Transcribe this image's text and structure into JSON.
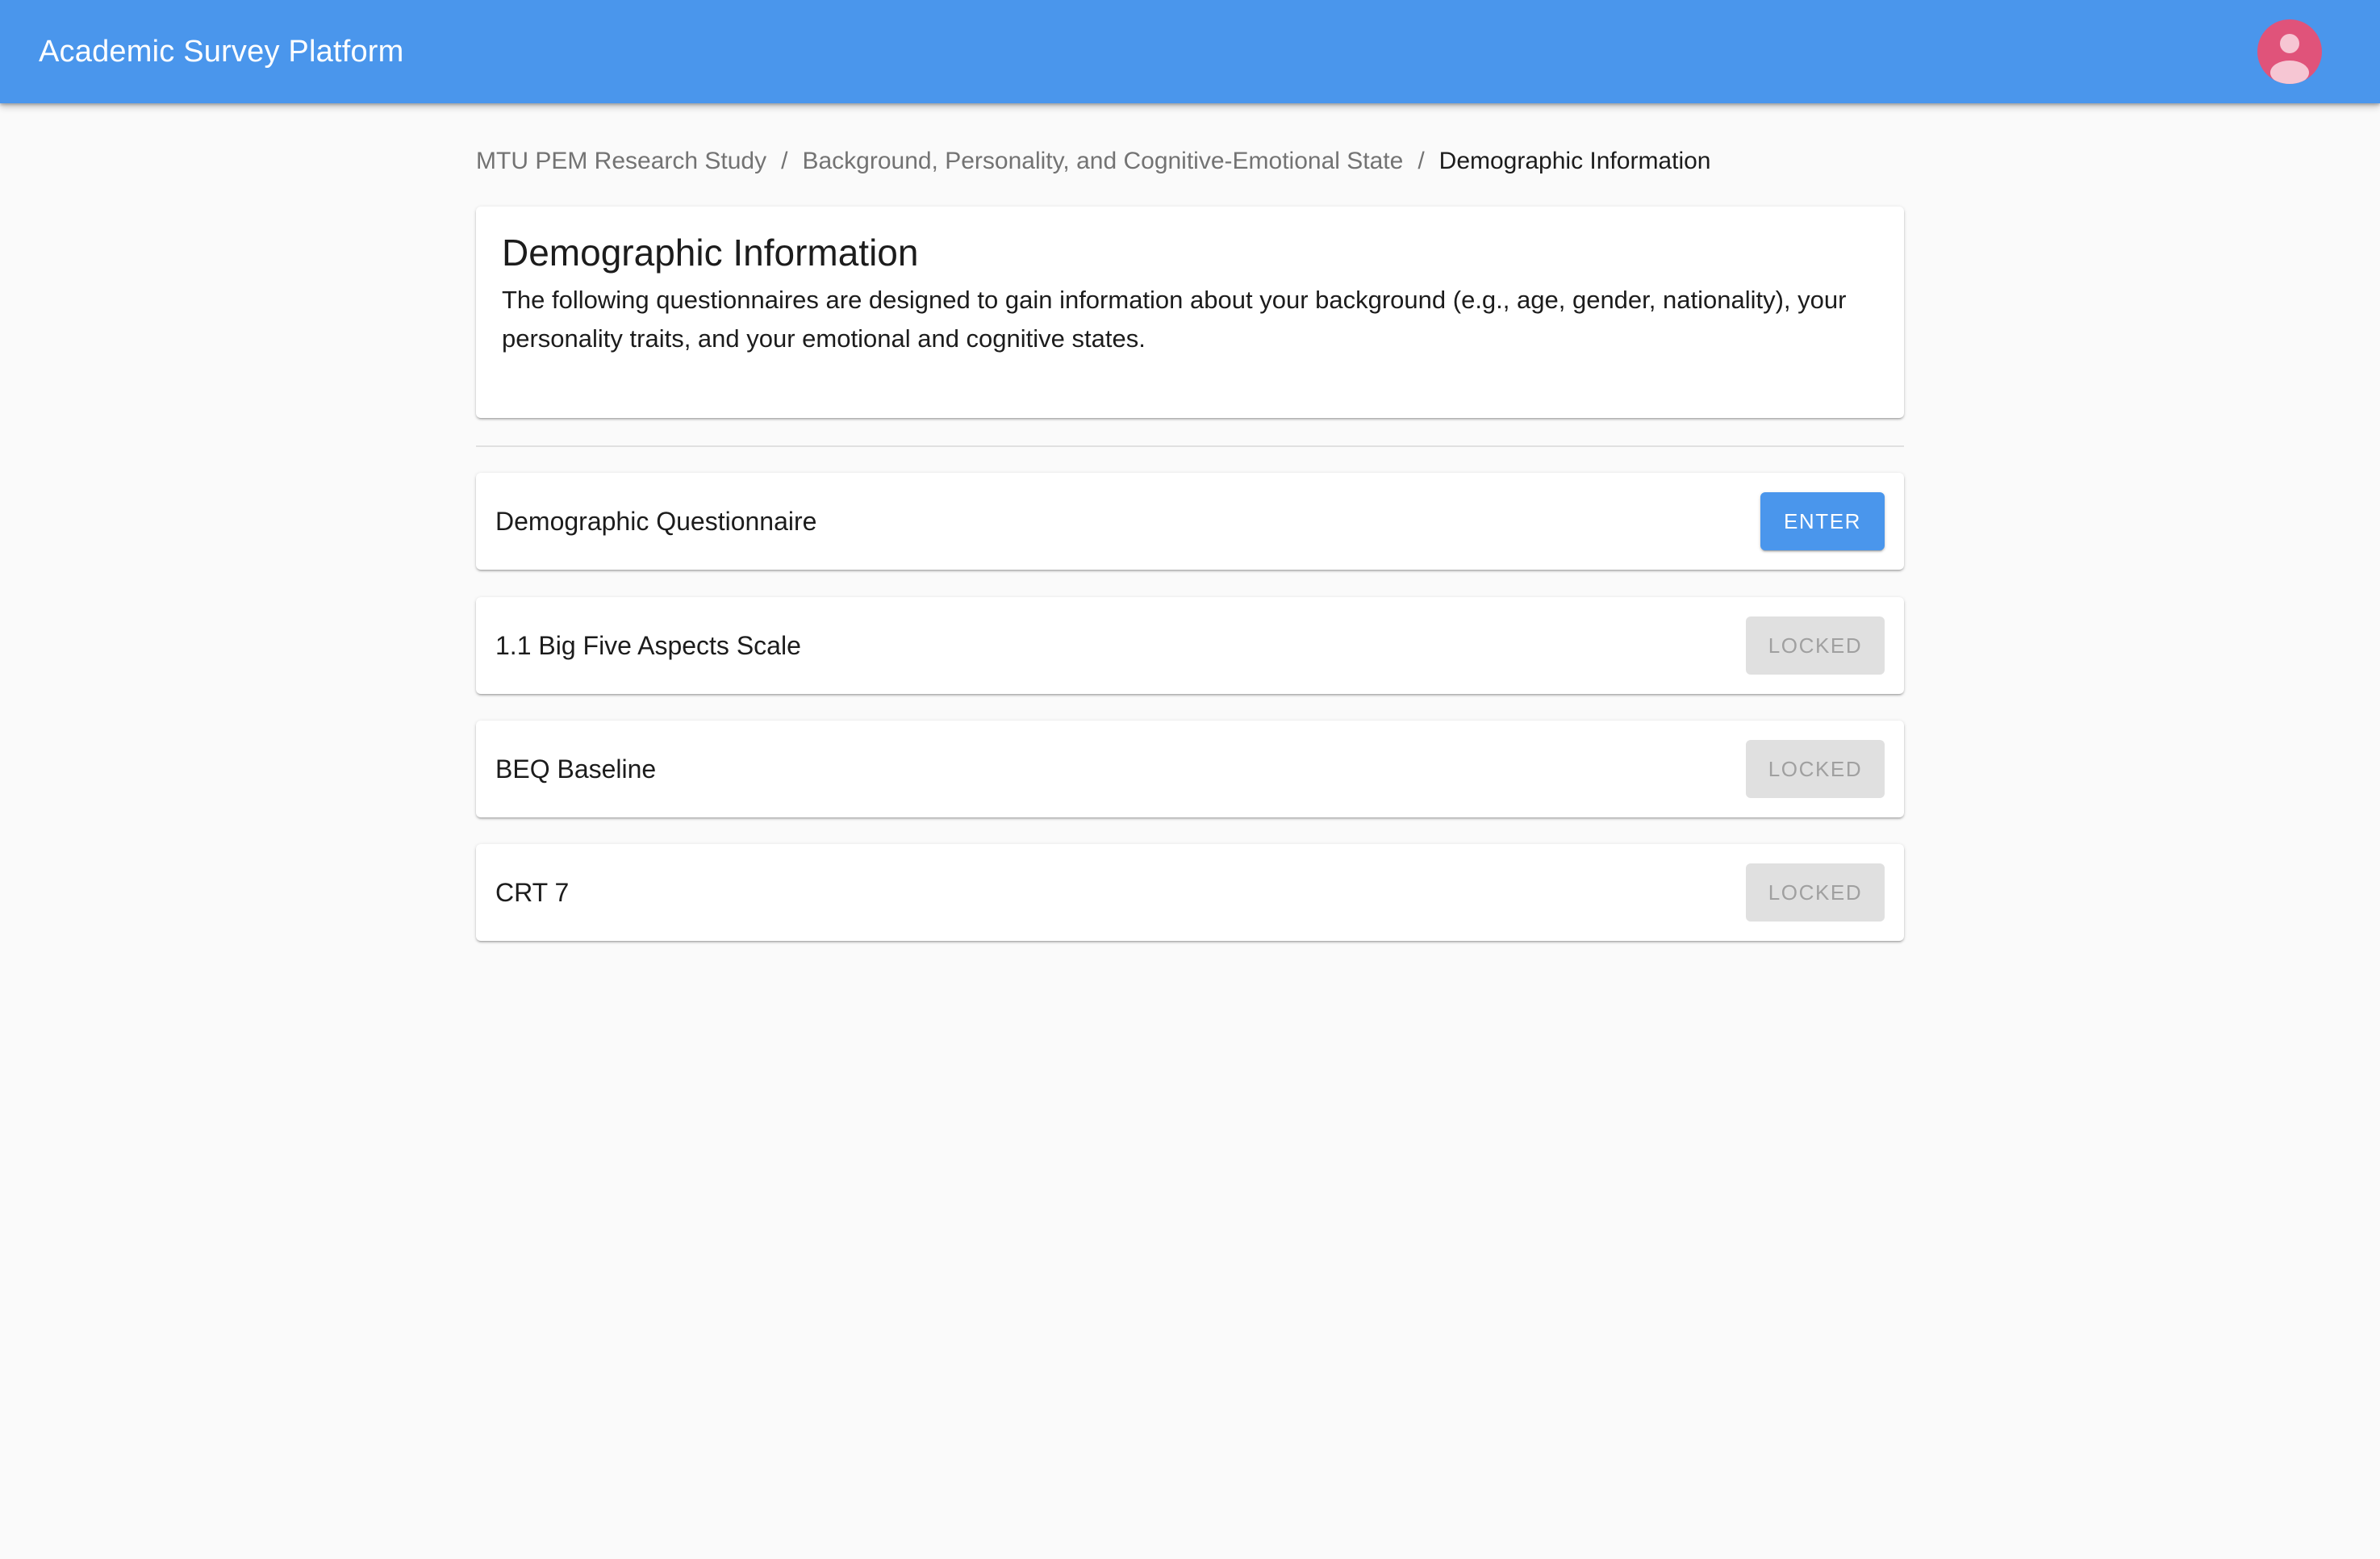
{
  "app": {
    "title": "Academic Survey Platform",
    "avatar_icon": "account-icon"
  },
  "breadcrumb": {
    "items": [
      "MTU PEM Research Study",
      "Background, Personality, and Cognitive-Emotional State"
    ],
    "separator": "/",
    "current": "Demographic Information"
  },
  "section": {
    "title": "Demographic Information",
    "description": "The following questionnaires are designed to gain information about your background (e.g., age, gender, nationality), your personality traits, and your emotional and cognitive states."
  },
  "questionnaires": [
    {
      "name": "Demographic Questionnaire",
      "action": "ENTER",
      "status": "available"
    },
    {
      "name": "1.1 Big Five Aspects Scale",
      "action": "LOCKED",
      "status": "locked"
    },
    {
      "name": "BEQ Baseline",
      "action": "LOCKED",
      "status": "locked"
    },
    {
      "name": "CRT 7",
      "action": "LOCKED",
      "status": "locked"
    }
  ],
  "colors": {
    "primary": "#4a96ec",
    "avatar": "#e0537a",
    "background": "#fafafa",
    "locked_bg": "#e0e0e0",
    "locked_text": "#a0a0a0"
  }
}
